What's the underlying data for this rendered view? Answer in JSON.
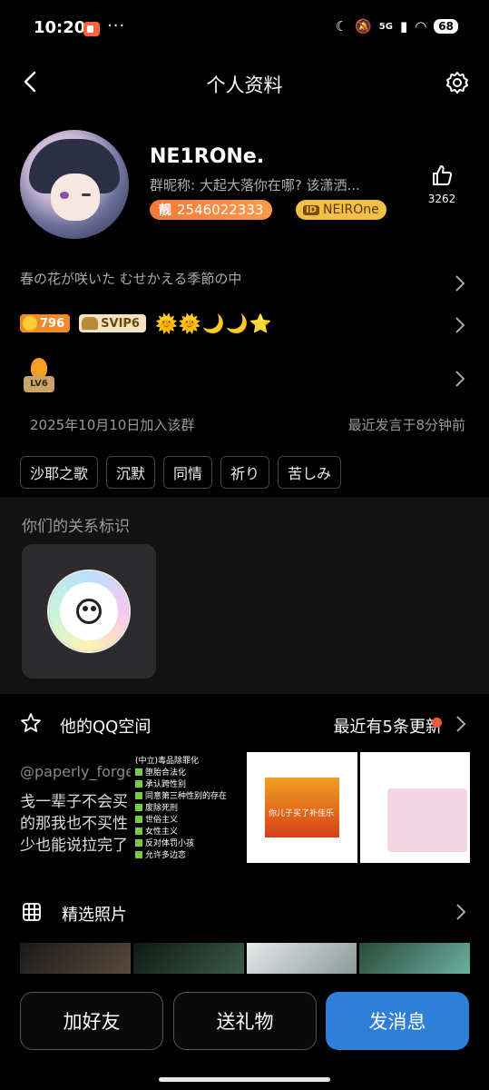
{
  "status_bar": {
    "time": "10:20",
    "dots": "···",
    "network": "5G",
    "battery": "68"
  },
  "header": {
    "title": "个人资料"
  },
  "profile": {
    "name": "NE1RONe.",
    "group_nickname": "群昵称: 大起大落你在哪? 该潇洒...",
    "liang_label": "靓",
    "qq_number": "2546022333",
    "id_label": "ID",
    "id_name": "NEIROne",
    "likes": "3262"
  },
  "signature": "春の花が咲いた むせかえる季節の中",
  "levels": {
    "coins": "796",
    "svip": "SVIP6",
    "medals": "🌞🌞🌙🌙⭐"
  },
  "group_level": {
    "badge": "LV6",
    "joined": "2025年10月10日加入该群",
    "last_spoke": "最近发言于8分钟前"
  },
  "tags": [
    "沙耶之歌",
    "沉默",
    "同情",
    "祈り",
    "苦しみ"
  ],
  "relation": {
    "title": "你们的关系标识"
  },
  "qzone": {
    "title": "他的QQ空间",
    "update": "最近有5条更新",
    "thumb1": {
      "handle": "@paperly_forge",
      "lines": [
        "戋一辈子不会买",
        "的那我也不买性",
        "少也能说拉完了"
      ]
    },
    "thumb2": {
      "title": "(中立)毒品除罪化",
      "items": [
        "堕胎合法化",
        "承认跨性别",
        "同意第三种性别的存在",
        "废除死刑",
        "世俗主义",
        "女性主义",
        "反对体罚小孩",
        "允许多边恋"
      ]
    },
    "thumb3": {
      "poster_text": "你儿子买了补佳乐"
    }
  },
  "photos": {
    "title": "精选照片"
  },
  "actions": {
    "add_friend": "加好友",
    "send_gift": "送礼物",
    "send_message": "发消息"
  },
  "colors": {
    "accent_blue": "#2f7fd8",
    "liang_orange": "#f07a3a",
    "id_gold": "#f2c04a",
    "update_dot": "#f05a3a"
  }
}
